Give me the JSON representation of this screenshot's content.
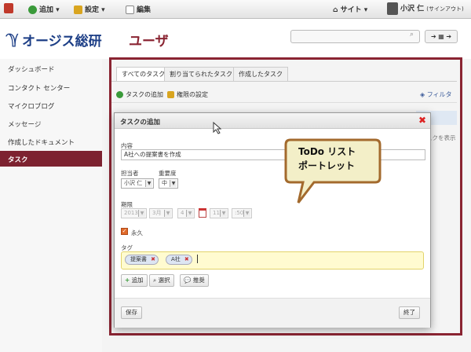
{
  "topbar": {
    "add_label": "追加",
    "settings_label": "設定",
    "edit_label": "編集",
    "site_label": "サイト",
    "user_label": "小沢 仁",
    "logout_label": "(サインアウト)"
  },
  "header": {
    "logo_text": "オージス総研",
    "page_title": "ユーザ",
    "search_placeholder": ""
  },
  "sidebar": {
    "items": [
      {
        "label": "ダッシュボード"
      },
      {
        "label": "コンタクト センター"
      },
      {
        "label": "マイクロブログ"
      },
      {
        "label": "メッセージ"
      },
      {
        "label": "作成したドキュメント"
      },
      {
        "label": "タスク"
      }
    ]
  },
  "tasks": {
    "tabs": [
      {
        "label": "すべてのタスク"
      },
      {
        "label": "割り当てられたタスク"
      },
      {
        "label": "作成したタスク"
      }
    ],
    "add_task_label": "タスクの追加",
    "permissions_label": "権限の設定",
    "filter_label": "フィルタ",
    "behind_text": "スクを表示"
  },
  "modal": {
    "title": "タスクの追加",
    "content_label": "内容",
    "content_value": "A社への提案書を作成",
    "assignee_label": "担当者",
    "assignee_value": "小沢 仁",
    "importance_label": "重要度",
    "importance_value": "中",
    "due_label": "期限",
    "due_year": "2013",
    "due_month": "3月",
    "due_day": "4",
    "due_hour": "11",
    "due_minute": ":50",
    "permanent_label": "永久",
    "tags_label": "タグ",
    "tags": [
      {
        "label": "提案書"
      },
      {
        "label": "A社"
      }
    ],
    "add_button": "追加",
    "select_button": "選択",
    "suggest_button": "推奨",
    "save_button": "保存",
    "close_button": "終了"
  },
  "callout": {
    "line1": "ToDo リスト",
    "line2": "ポートレット"
  },
  "colors": {
    "accent": "#8a2432",
    "logo": "#1c3e86",
    "tag_bg": "#fffbd0",
    "callout_bg": "#f3efc8",
    "callout_border": "#a36a2d"
  }
}
